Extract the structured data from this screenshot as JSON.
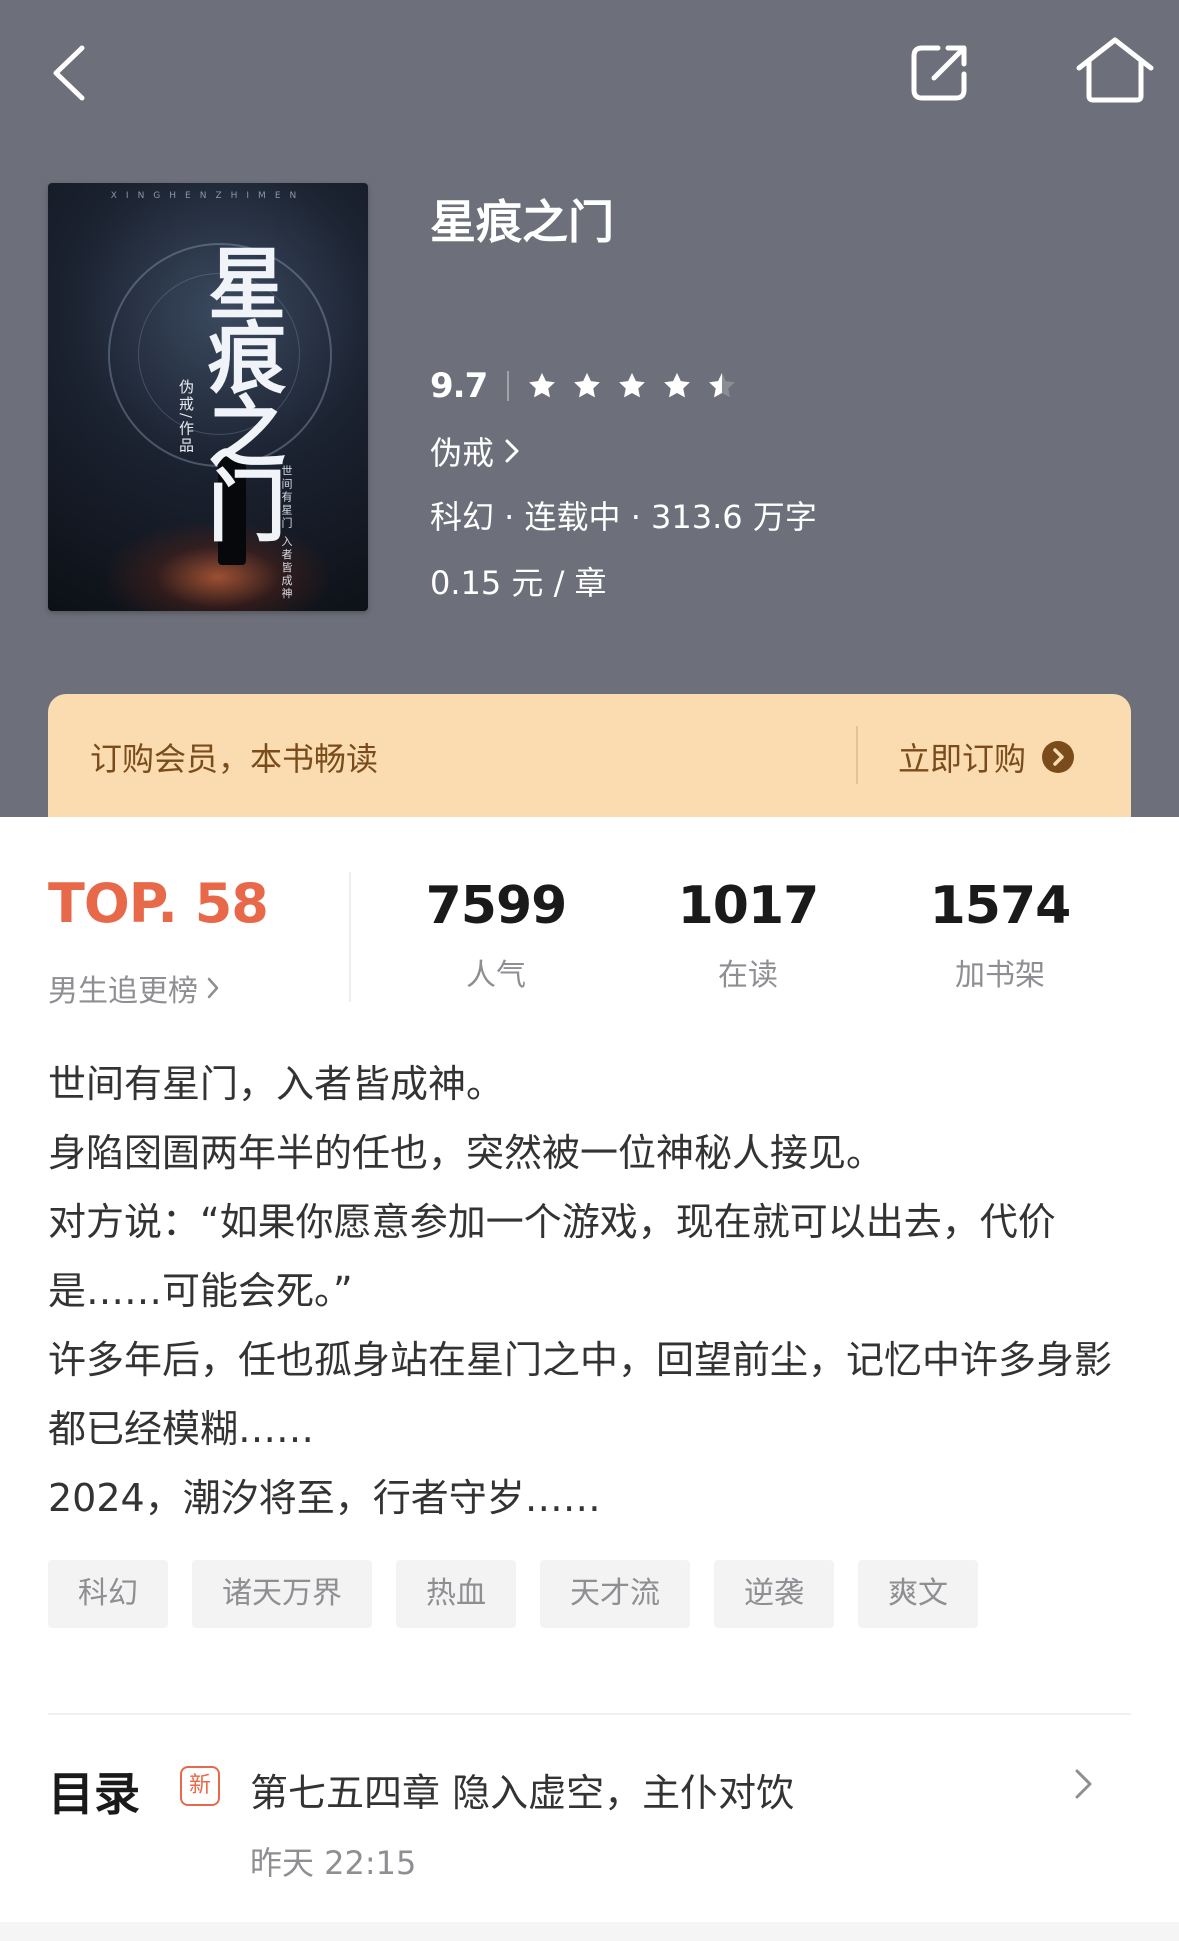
{
  "book": {
    "title": "星痕之门",
    "score": "9.7",
    "rating_stars": 4.5,
    "author": "伪戒",
    "meta": "科幻 · 连载中 · 313.6 万字",
    "price": "0.15 元 / 章"
  },
  "cover": {
    "top_text": "XINGHENZHIMEN",
    "big_title": "星痕之门",
    "author_text": "伪戒/作品",
    "side_text": "世间有星门 入者皆成神"
  },
  "member": {
    "text": "订购会员，本书畅读",
    "cta": "立即订购"
  },
  "rank": {
    "value": "TOP. 58",
    "label": "男生追更榜"
  },
  "stats": [
    {
      "num": "7599",
      "label": "人气"
    },
    {
      "num": "1017",
      "label": "在读"
    },
    {
      "num": "1574",
      "label": "加书架"
    }
  ],
  "description": [
    "世间有星门，入者皆成神。",
    "身陷囹圄两年半的任也，突然被一位神秘人接见。",
    "对方说：“如果你愿意参加一个游戏，现在就可以出去，代价是……可能会死。”",
    "许多年后，任也孤身站在星门之中，回望前尘，记忆中许多身影都已经模糊……",
    "2024，潮汐将至，行者守岁……"
  ],
  "tags": [
    "科幻",
    "诸天万界",
    "热血",
    "天才流",
    "逆袭",
    "爽文"
  ],
  "toc": {
    "title": "目录",
    "badge": "新",
    "latest_chapter": "第七五四章 隐入虚空，主仆对饮",
    "updated": "昨天 22:15"
  },
  "colors": {
    "header_bg": "#6d707a",
    "member_bg": "#fbdcb0",
    "rank_accent": "#e8694a"
  },
  "icons": [
    "back-icon",
    "share-icon",
    "home-icon",
    "star-icon",
    "chevron-right-icon",
    "arrow-circle-icon"
  ]
}
